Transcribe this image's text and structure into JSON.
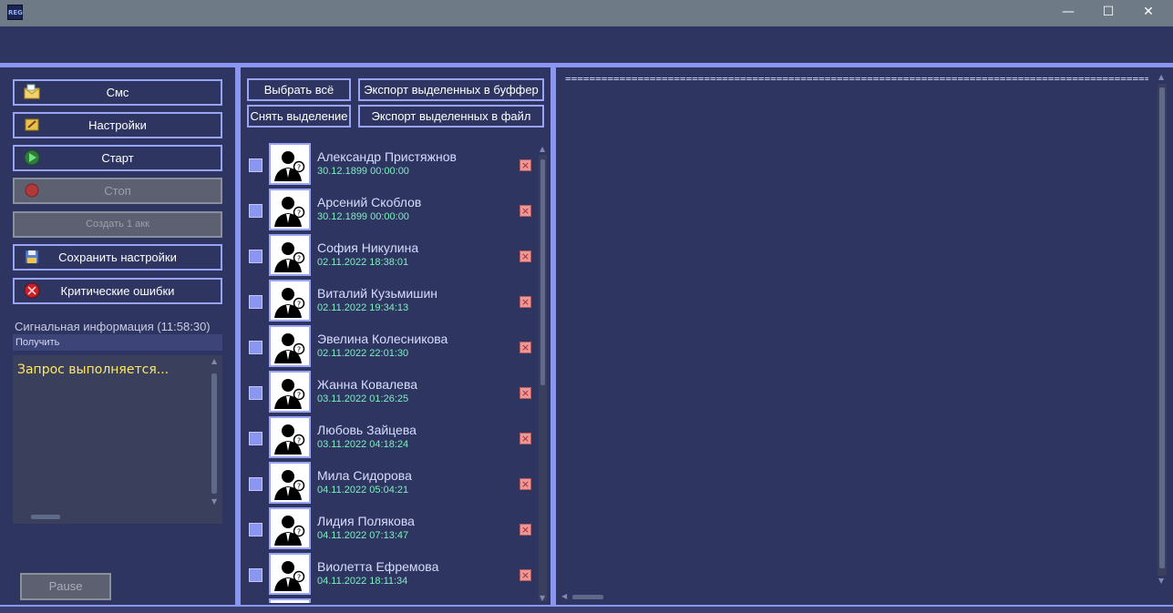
{
  "window": {
    "app_icon_text": "REG",
    "controls": {
      "minimize": "—",
      "maximize": "☐",
      "close": "✕"
    }
  },
  "sidebar": {
    "buttons": [
      {
        "label": "Смс",
        "icon": "sms-envelope-icon",
        "enabled": true
      },
      {
        "label": "Настройки",
        "icon": "settings-note-icon",
        "enabled": true
      },
      {
        "label": "Старт",
        "icon": "play-icon",
        "enabled": true
      },
      {
        "label": "Стоп",
        "icon": "stop-icon",
        "enabled": false
      },
      {
        "label": "Создать 1 акк",
        "icon": "",
        "enabled": false
      },
      {
        "label": "Сохранить настройки",
        "icon": "save-disk-icon",
        "enabled": true
      },
      {
        "label": "Критические ошибки",
        "icon": "critical-error-icon",
        "enabled": true
      }
    ],
    "signal_title": "Сигнальная информация (11:58:30)",
    "signal_get_label": "Получить",
    "log_text": "Запрос выполняется...",
    "pause_label": "Pause"
  },
  "contacts": {
    "select_all": "Выбрать всё",
    "export_buffer": "Экспорт выделенных в буффер",
    "deselect": "Снять выделение",
    "export_file": "Экспорт выделенных в файл",
    "items": [
      {
        "name": "Александр Пристяжнов",
        "date": "30.12.1899 00:00:00"
      },
      {
        "name": "Арсений Скоблов",
        "date": "30.12.1899 00:00:00"
      },
      {
        "name": "София Никулина",
        "date": "02.11.2022 18:38:01"
      },
      {
        "name": "Виталий Кузьмишин",
        "date": "02.11.2022 19:34:13"
      },
      {
        "name": "Эвелина Колесникова",
        "date": "02.11.2022 22:01:30"
      },
      {
        "name": "Жанна Ковалева",
        "date": "03.11.2022 01:26:25"
      },
      {
        "name": "Любовь Зайцева",
        "date": "03.11.2022 04:18:24"
      },
      {
        "name": "Мила Сидорова",
        "date": "04.11.2022 05:04:21"
      },
      {
        "name": "Лидия Полякова",
        "date": "04.11.2022 07:13:47"
      },
      {
        "name": "Виолетта Ефремова",
        "date": "04.11.2022 18:11:34"
      }
    ]
  },
  "output": {
    "text": "=================================================================================================="
  },
  "colors": {
    "background": "#2e3560",
    "border": "#9aa4f6",
    "name_text": "#d8dcff",
    "date_text": "#7ef0c0",
    "log_text": "#ffe866"
  }
}
